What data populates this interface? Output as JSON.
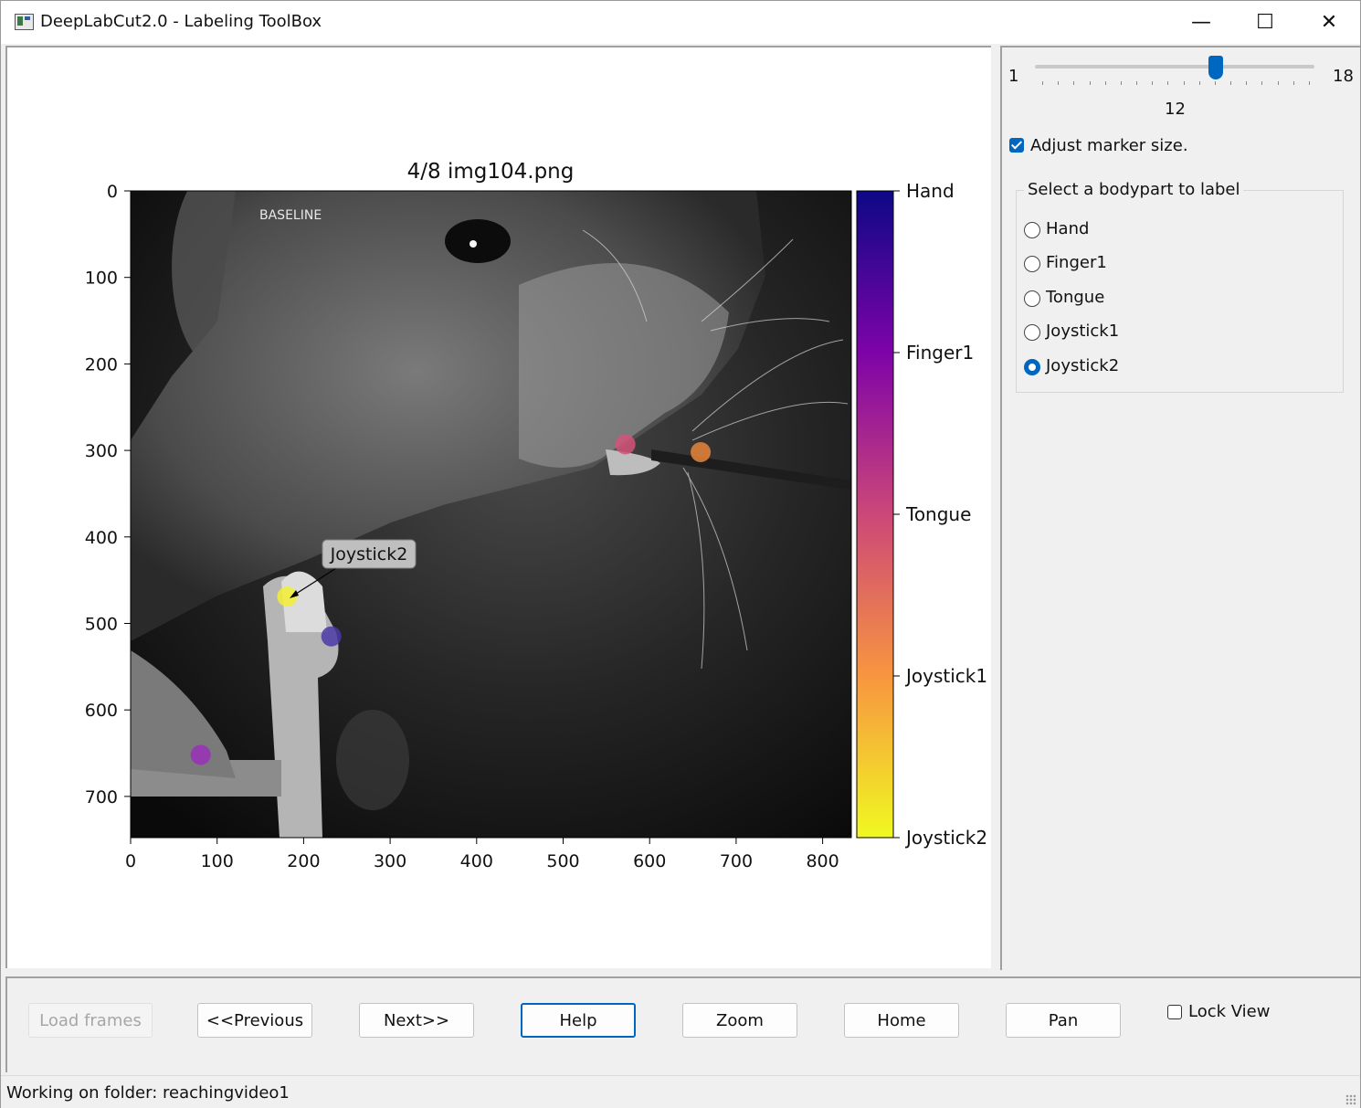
{
  "window": {
    "title": "DeepLabCut2.0 - Labeling ToolBox",
    "minimize": "—",
    "maximize": "☐",
    "close": "✕"
  },
  "plot": {
    "title": "4/8 img104.png",
    "overlay_text": "BASELINE",
    "annotation": "Joystick2",
    "x_ticks": [
      "0",
      "100",
      "200",
      "300",
      "400",
      "500",
      "600",
      "700",
      "800"
    ],
    "y_ticks": [
      "0",
      "100",
      "200",
      "300",
      "400",
      "500",
      "600",
      "700"
    ],
    "colorbar_labels": [
      "Hand",
      "Finger1",
      "Tongue",
      "Joystick1",
      "Joystick2"
    ],
    "points": [
      {
        "bodypart": "Hand",
        "x": 232,
        "y": 515,
        "color": "#4b3aa8"
      },
      {
        "bodypart": "Finger1",
        "x": 81,
        "y": 652,
        "color": "#9b2fb8"
      },
      {
        "bodypart": "Tongue",
        "x": 572,
        "y": 293,
        "color": "#d4537a"
      },
      {
        "bodypart": "Joystick1",
        "x": 659,
        "y": 302,
        "color": "#e6853a"
      },
      {
        "bodypart": "Joystick2",
        "x": 181,
        "y": 469,
        "color": "#f2f035"
      }
    ]
  },
  "slider": {
    "min": "1",
    "max": "18",
    "value": "12"
  },
  "marker_size": {
    "label": "Adjust marker size.",
    "checked": true
  },
  "bodypart_group": {
    "title": "Select a bodypart to label",
    "options": [
      "Hand",
      "Finger1",
      "Tongue",
      "Joystick1",
      "Joystick2"
    ],
    "selected": "Joystick2"
  },
  "buttons": {
    "load_frames": "Load frames",
    "previous": "<<Previous",
    "next": "Next>>",
    "help": "Help",
    "zoom": "Zoom",
    "home": "Home",
    "pan": "Pan"
  },
  "lock_view": {
    "label": "Lock View",
    "checked": false
  },
  "status": "Working on folder: reachingvideo1"
}
